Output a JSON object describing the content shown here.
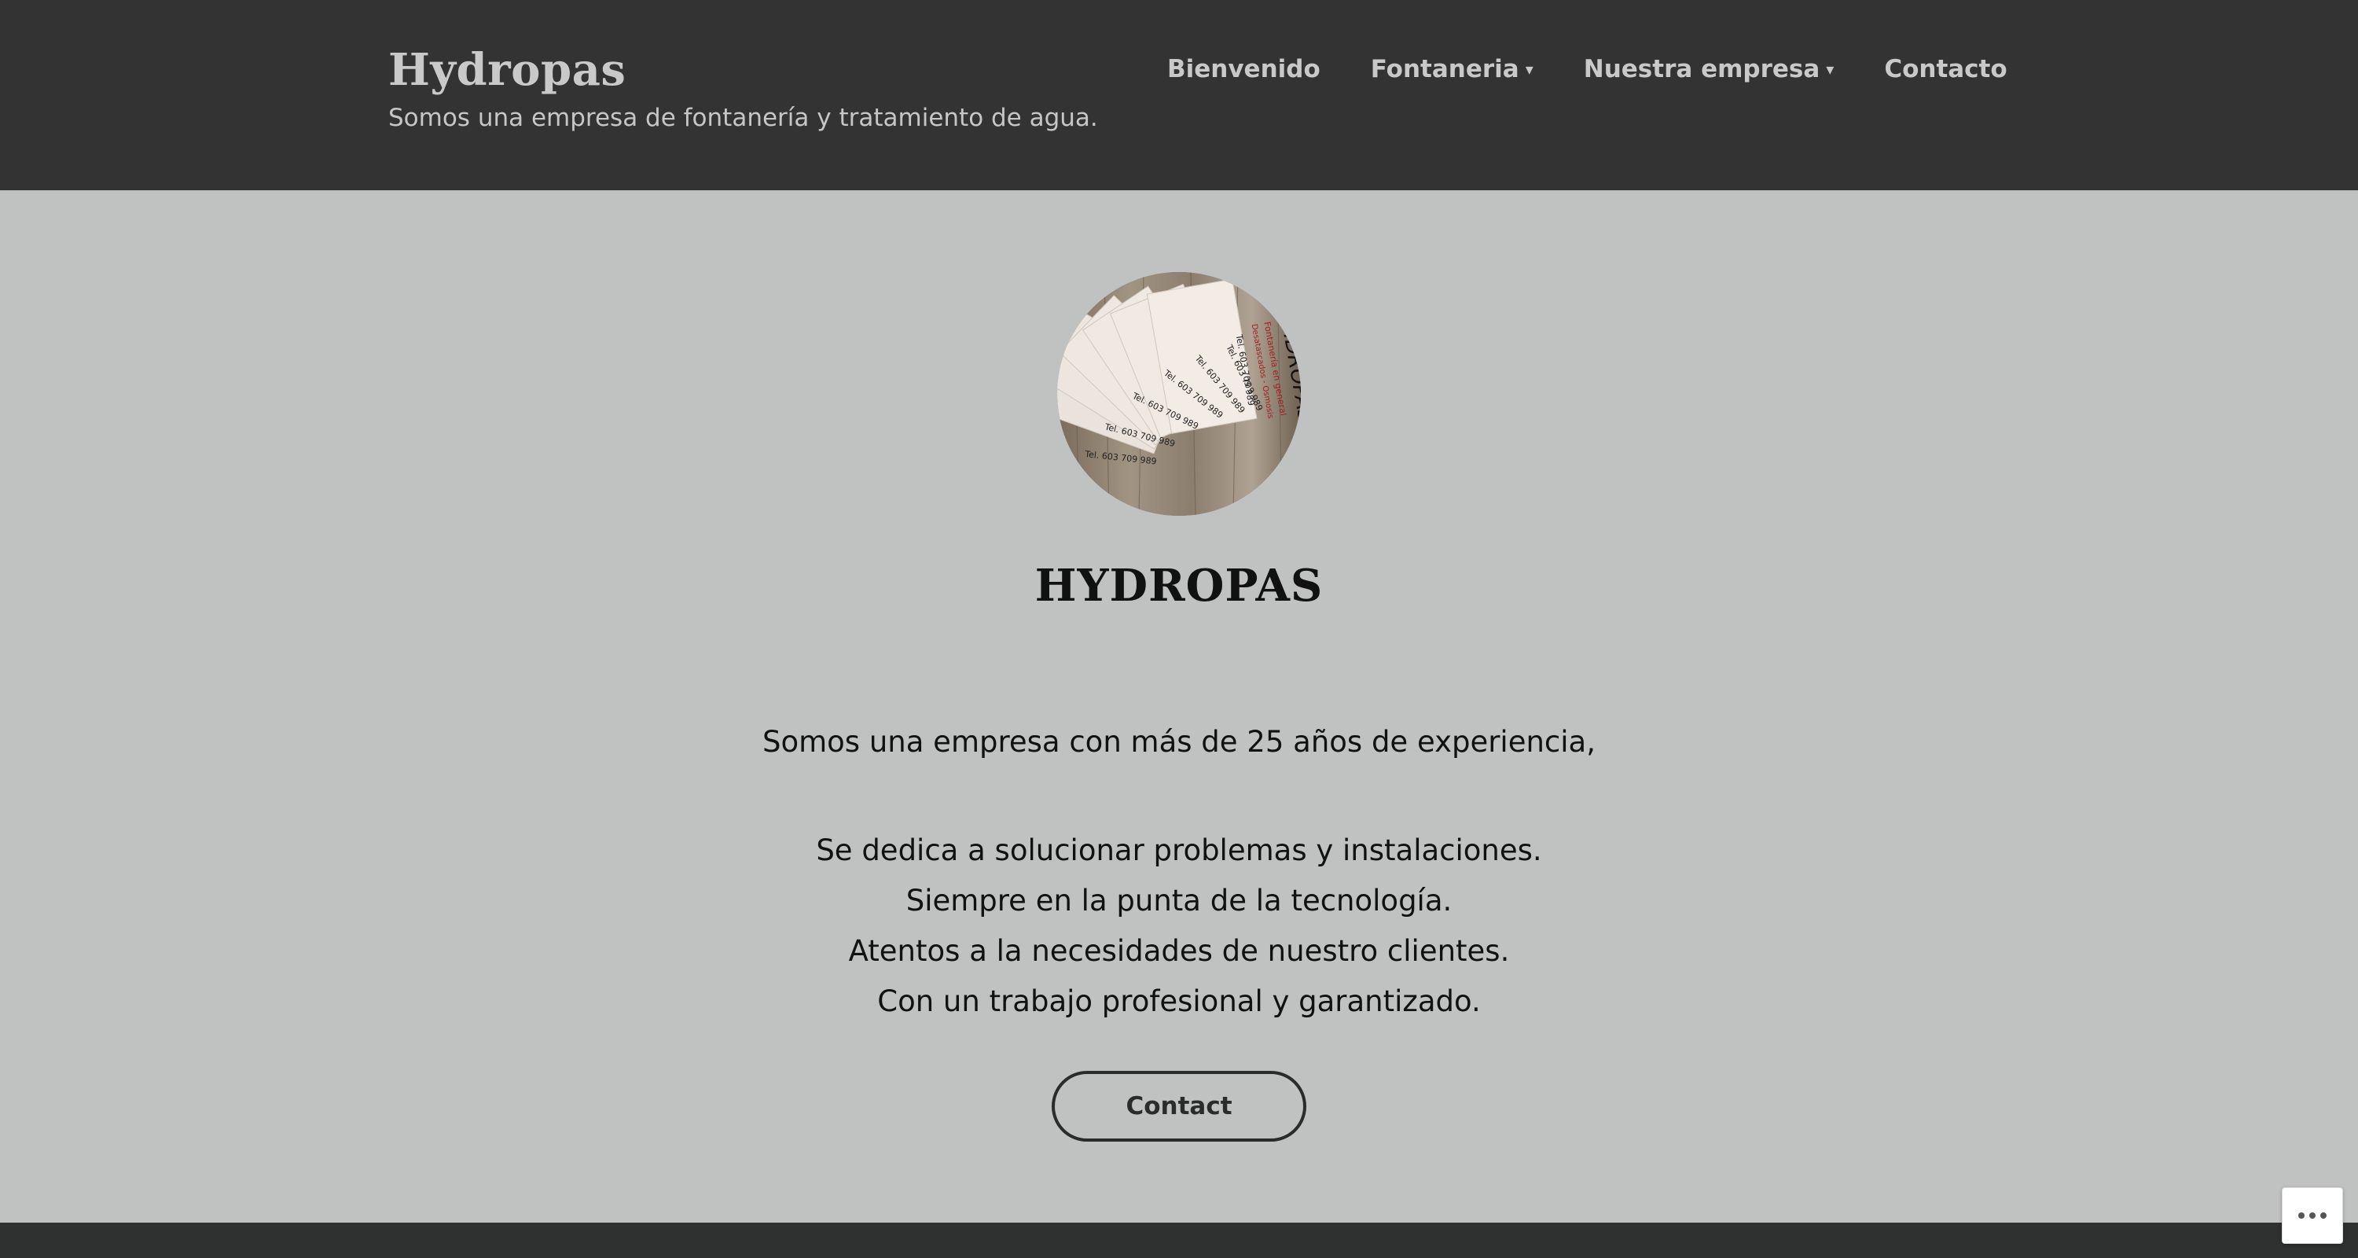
{
  "header": {
    "site_title": "Hydropas",
    "tagline": "Somos una empresa de fontanería y tratamiento de agua."
  },
  "nav": {
    "items": [
      {
        "label": "Bienvenido",
        "has_dropdown": false
      },
      {
        "label": "Fontaneria",
        "has_dropdown": true
      },
      {
        "label": "Nuestra empresa",
        "has_dropdown": true
      },
      {
        "label": "Contacto",
        "has_dropdown": false
      }
    ],
    "caret": "▾"
  },
  "hero": {
    "logo_text": {
      "brand": "HIDROPAS",
      "line1": "Fontanería en general",
      "line2": "Desatascados - Osmosis",
      "phone": "Tel. 603 709 989"
    },
    "heading": "HYDROPAS",
    "intro": "Somos una empresa con más de 25 años de experiencia,",
    "lines": [
      "Se dedica a solucionar problemas y instalaciones.",
      "Siempre en la punta de la tecnología.",
      "Atentos a la necesidades de nuestro clientes.",
      "Con un trabajo profesional y garantizado."
    ],
    "contact_label": "Contact"
  },
  "colors": {
    "header_bg": "#333333",
    "main_bg": "#c0c2c1",
    "footer_bg": "#2f3030",
    "text_dark": "#111111",
    "header_text": "#c9c9c9"
  },
  "icons": {
    "more": "more-horizontal-icon"
  }
}
